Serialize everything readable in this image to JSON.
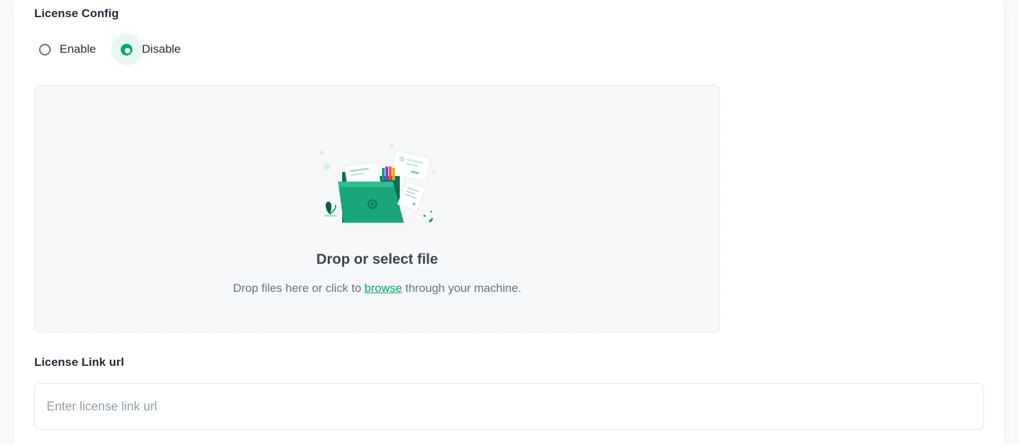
{
  "license_config": {
    "title": "License Config",
    "options": [
      {
        "label": "Enable",
        "checked": false
      },
      {
        "label": "Disable",
        "checked": true
      }
    ]
  },
  "upload": {
    "title": "Drop or select file",
    "description_before": "Drop files here or click to",
    "browse_label": "browse",
    "description_after": "through your machine."
  },
  "license_link": {
    "title": "License Link url",
    "value": "",
    "placeholder": "Enter license link url"
  },
  "colors": {
    "accent": "#00a76f",
    "text_primary": "#212b36",
    "text_secondary": "#637381",
    "dropzone_bg": "#f6f7f8"
  },
  "icons": {
    "upload_illustration": "folder-upload-illustration"
  }
}
